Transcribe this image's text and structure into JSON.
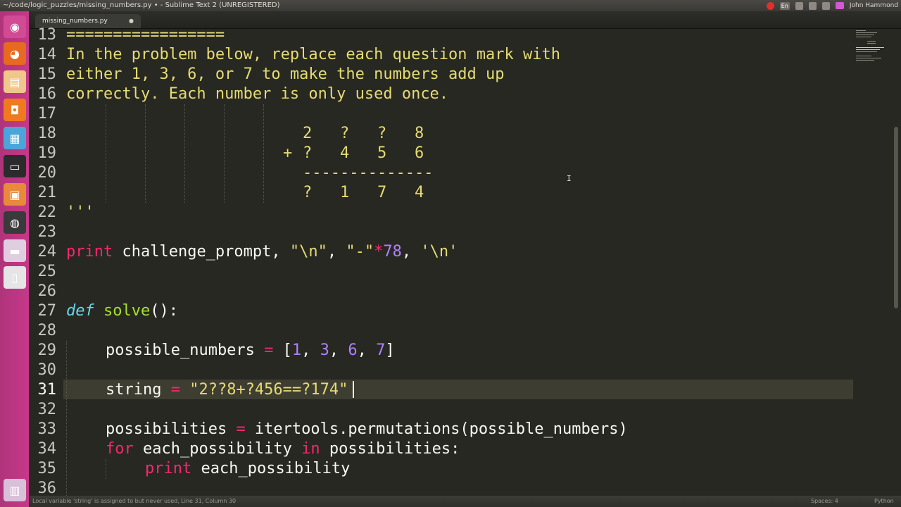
{
  "window": {
    "title": "~/code/logic_puzzles/missing_numbers.py • - Sublime Text 2 (UNREGISTERED)",
    "user": "John Hammond",
    "tray_lang": "En"
  },
  "tab": {
    "label": "missing_numbers.py",
    "dirty_mark": "●"
  },
  "gutter": {
    "lines": [
      "13",
      "14",
      "15",
      "16",
      "17",
      "18",
      "19",
      "20",
      "21",
      "22",
      "23",
      "24",
      "25",
      "26",
      "27",
      "28",
      "29",
      "30",
      "31",
      "32",
      "33",
      "34",
      "35",
      "36"
    ],
    "active_line": "31"
  },
  "code": {
    "l13": "=================",
    "l14": "In the problem below, replace each question mark with",
    "l15": "either 1, 3, 6, or 7 to make the numbers add up",
    "l16": "correctly. Each number is only used once.",
    "l18": "2   ?   ?   8",
    "l19_plus": "+",
    "l19": "?   4   5   6",
    "l20": "--------------",
    "l21": "?   1   7   4",
    "l22": "'''",
    "l24": {
      "kw": "print",
      "ident": " challenge_prompt, ",
      "s1": "\"\\n\"",
      "comma1": ", ",
      "s2": "\"-\"",
      "mul": "*",
      "n78": "78",
      "comma2": ", ",
      "s3": "'\\n'"
    },
    "l27": {
      "kw": "def",
      "fn": "solve",
      "rest": "():"
    },
    "l29": {
      "ident": "possible_numbers ",
      "eq": "=",
      "open": " [",
      "n1": "1",
      "c1": ", ",
      "n3": "3",
      "c2": ", ",
      "n6": "6",
      "c3": ", ",
      "n7": "7",
      "close": "]"
    },
    "l31": {
      "ident": "string ",
      "eq": "=",
      "sp": " ",
      "str": "\"2??8+?456==?174\""
    },
    "l33": {
      "ident": "possibilities ",
      "eq": "=",
      "rest": " itertools.permutations(possible_numbers)"
    },
    "l34": {
      "kw": "for",
      "mid": " each_possibility ",
      "kw2": "in",
      "rest": " possibilities:"
    },
    "l35": {
      "kw": "print",
      "rest": " each_possibility"
    }
  },
  "statusbar": {
    "message": "Local variable 'string' is assigned to but never used, Line 31, Column 30",
    "spaces": "Spaces: 4",
    "syntax": "Python"
  }
}
